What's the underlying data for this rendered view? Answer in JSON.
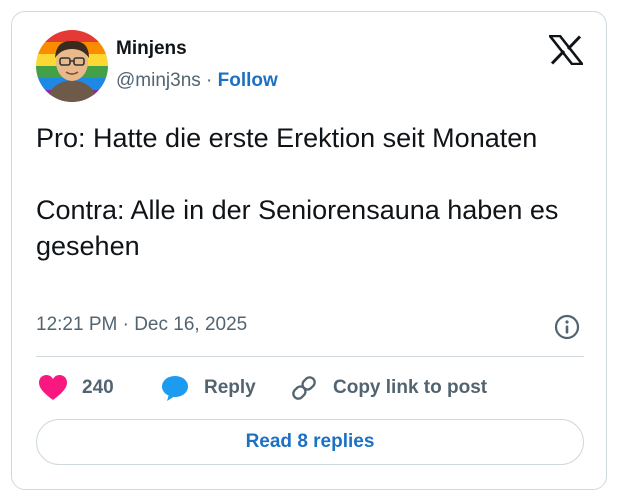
{
  "author": {
    "name": "Minjens",
    "handle": "@minj3ns",
    "separator": "·",
    "follow_label": "Follow"
  },
  "tweet": {
    "text_line1": "Pro: Hatte die erste Erektion seit Monaten",
    "text_line2": "Contra: Alle in der Seniorensauna haben es gesehen",
    "timestamp": "12:21 PM · Dec 16, 2025"
  },
  "actions": {
    "like_count": "240",
    "reply_label": "Reply",
    "copy_label": "Copy link to post"
  },
  "read_replies_label": "Read 8 replies",
  "colors": {
    "like": "#f91880",
    "reply": "#1d9bf0",
    "link_blue": "#1d71c4",
    "muted": "#536471",
    "text": "#0f1419",
    "border": "#cfd9de"
  },
  "icons": [
    "x-logo-icon",
    "info-icon",
    "heart-icon",
    "reply-bubble-icon",
    "link-icon"
  ]
}
